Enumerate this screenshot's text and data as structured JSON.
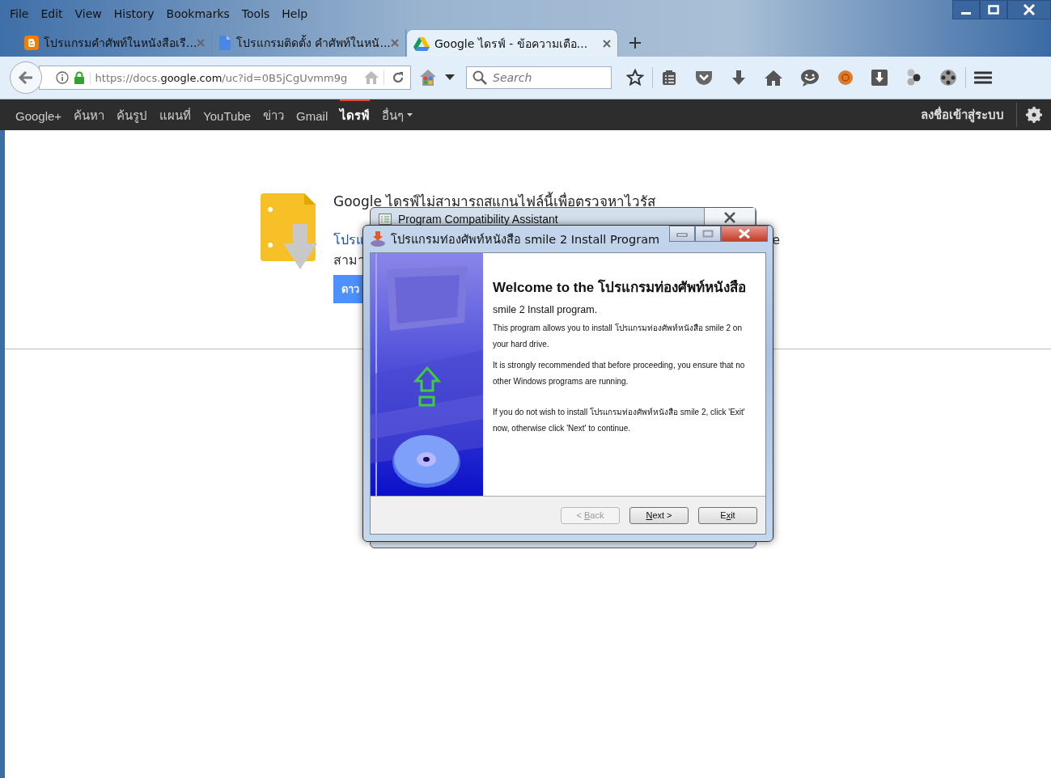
{
  "menu_bar": [
    "File",
    "Edit",
    "View",
    "History",
    "Bookmarks",
    "Tools",
    "Help"
  ],
  "tabs": [
    {
      "title": "โปรแกรมคำศัพท์ในหนังสือเรี...",
      "kind": "blogger",
      "selected": false
    },
    {
      "title": "โปรแกรมติดตั้ง คำศัพท์ในหนั...",
      "kind": "doc",
      "selected": false
    },
    {
      "title": "Google ไดรฟ์ - ข้อความเตือ...",
      "kind": "drive",
      "selected": true
    }
  ],
  "address_bar": {
    "url_prefix": "https://docs.",
    "url_domain": "google.com",
    "url_rest": "/uc?id=0B5jCgUvmm9g"
  },
  "search": {
    "placeholder": "Search"
  },
  "google_bar": {
    "items": [
      {
        "label": "Google+",
        "selected": false
      },
      {
        "label": "ค้นหา",
        "selected": false
      },
      {
        "label": "ค้นรูป",
        "selected": false
      },
      {
        "label": "แผนที่",
        "selected": false
      },
      {
        "label": "YouTube",
        "selected": false
      },
      {
        "label": "ข่าว",
        "selected": false
      },
      {
        "label": "Gmail",
        "selected": false
      },
      {
        "label": "ไดรฟ์",
        "selected": true
      },
      {
        "label": "อื่นๆ",
        "selected": false
      }
    ],
    "sign_in": "ลงชื่อเข้าสู่ระบบ"
  },
  "page": {
    "heading": "Google ไดรฟ์ไม่สามารถสแกนไฟล์นี้เพื่อตรวจหาไวรัส",
    "link_fragment": "โปรแ",
    "trailing_fragment": "e",
    "text_fragment": "สามา",
    "button_fragment": "ดาว"
  },
  "background_dialog": {
    "title": "Program Compatibility Assistant"
  },
  "dialog": {
    "title": "โปรแกรมท่องศัพท์หนังสือ smile 2 Install Program",
    "heading": "Welcome to the โปรแกรมท่องศัพท์หนังสือ",
    "subheading": "smile 2 Install program.",
    "paragraphs": [
      "This program allows you to install โปรแกรมท่องศัพท์หนังสือ smile 2 on your hard drive.",
      "It is strongly recommended that before proceeding, you ensure that no other Windows programs are running.",
      "If you do not wish to install โปรแกรมท่องศัพท์หนังสือ smile 2, click 'Exit' now, otherwise click 'Next' to continue."
    ],
    "buttons": [
      {
        "before": "< ",
        "key": "B",
        "after": "ack",
        "disabled": true
      },
      {
        "key": "N",
        "after": "ext >",
        "disabled": false
      },
      {
        "before": "E",
        "key": "x",
        "after": "it",
        "disabled": false
      }
    ]
  }
}
